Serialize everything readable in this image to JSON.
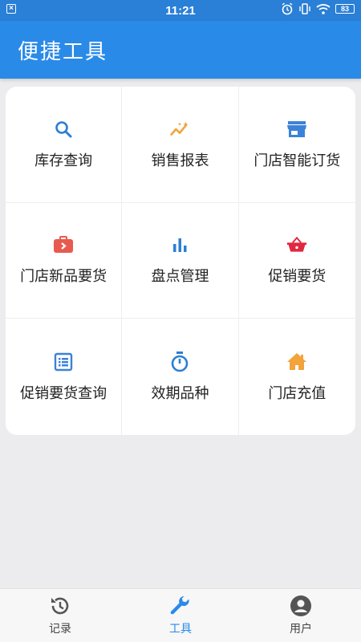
{
  "status_bar": {
    "time": "11:21",
    "battery": "83"
  },
  "header": {
    "title": "便捷工具"
  },
  "tools": [
    {
      "label": "库存查询",
      "icon": "search-icon",
      "color": "#2a7fd6"
    },
    {
      "label": "销售报表",
      "icon": "trend-icon",
      "color": "#f2a33a"
    },
    {
      "label": "门店智能订货",
      "icon": "store-icon",
      "color": "#3b82d8"
    },
    {
      "label": "门店新品要货",
      "icon": "suitcase-icon",
      "color": "#e85a4f"
    },
    {
      "label": "盘点管理",
      "icon": "bar-chart-icon",
      "color": "#2a7fd6"
    },
    {
      "label": "促销要货",
      "icon": "basket-icon",
      "color": "#e0283e"
    },
    {
      "label": "促销要货查询",
      "icon": "list-icon",
      "color": "#3b82d8"
    },
    {
      "label": "效期品种",
      "icon": "timer-icon",
      "color": "#2a7fd6"
    },
    {
      "label": "门店充值",
      "icon": "house-icon",
      "color": "#f2a33a"
    }
  ],
  "bottom_nav": [
    {
      "label": "记录",
      "icon": "history-icon",
      "active": false
    },
    {
      "label": "工具",
      "icon": "wrench-icon",
      "active": true
    },
    {
      "label": "用户",
      "icon": "user-icon",
      "active": false
    }
  ],
  "colors": {
    "primary": "#2a8ae8",
    "status_bar": "#2a7fd6"
  }
}
